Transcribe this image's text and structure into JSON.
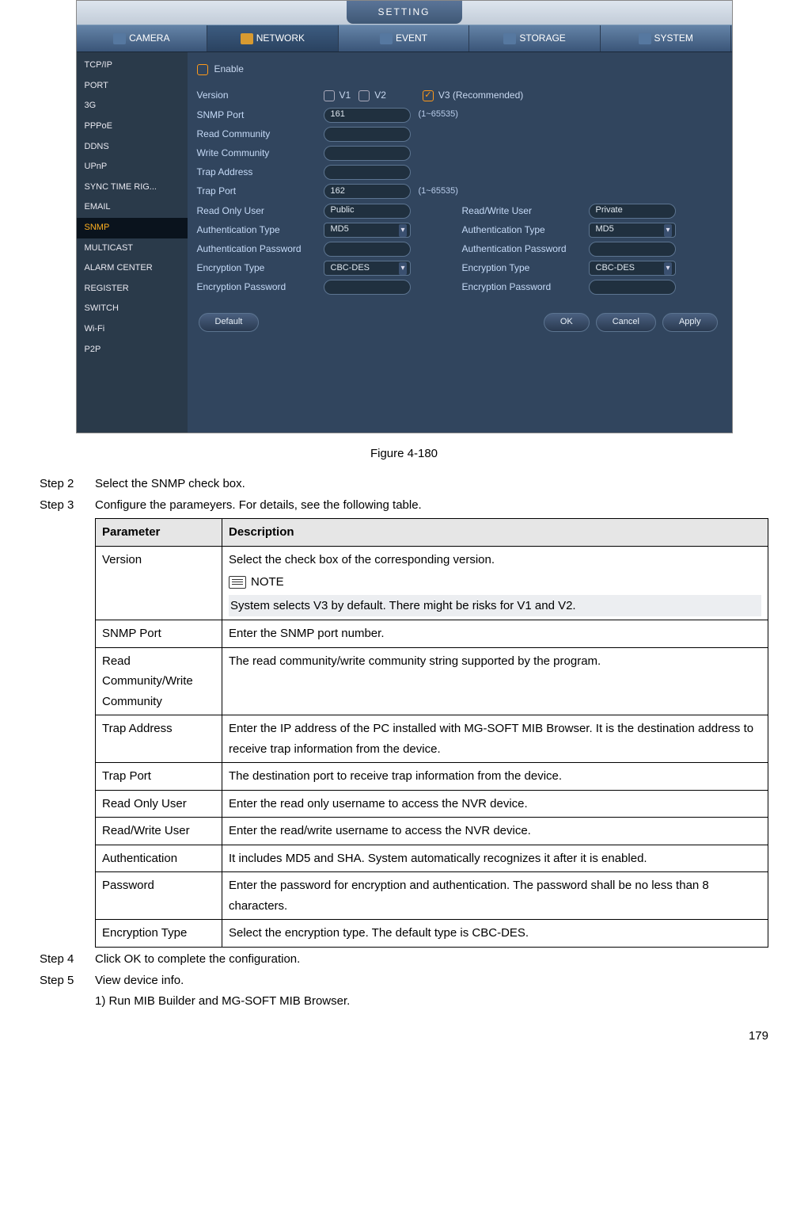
{
  "screenshot": {
    "title_tab": "SETTING",
    "main_tabs": [
      "CAMERA",
      "NETWORK",
      "EVENT",
      "STORAGE",
      "SYSTEM"
    ],
    "active_main_tab": 1,
    "sidebar": [
      "TCP/IP",
      "PORT",
      "3G",
      "PPPoE",
      "DDNS",
      "UPnP",
      "SYNC TIME RIG...",
      "EMAIL",
      "SNMP",
      "MULTICAST",
      "ALARM CENTER",
      "REGISTER",
      "SWITCH",
      "Wi-Fi",
      "P2P"
    ],
    "active_sidebar": 8,
    "enable_label": "Enable",
    "version_label": "Version",
    "v1": "V1",
    "v2": "V2",
    "v3": "V3 (Recommended)",
    "rows_left": [
      {
        "label": "SNMP Port",
        "value": "161",
        "hint": "(1~65535)",
        "type": "text"
      },
      {
        "label": "Read Community",
        "value": "",
        "type": "text"
      },
      {
        "label": "Write Community",
        "value": "",
        "type": "text"
      },
      {
        "label": "Trap Address",
        "value": "",
        "type": "text"
      },
      {
        "label": "Trap Port",
        "value": "162",
        "hint": "(1~65535)",
        "type": "text"
      },
      {
        "label": "Read Only User",
        "value": "Public",
        "type": "text"
      },
      {
        "label": "Authentication Type",
        "value": "MD5",
        "type": "select"
      },
      {
        "label": "Authentication Password",
        "value": "",
        "type": "text"
      },
      {
        "label": "Encryption Type",
        "value": "CBC-DES",
        "type": "select"
      },
      {
        "label": "Encryption Password",
        "value": "",
        "type": "text"
      }
    ],
    "rows_right": [
      {
        "label": "Read/Write User",
        "value": "Private",
        "type": "text"
      },
      {
        "label": "Authentication Type",
        "value": "MD5",
        "type": "select"
      },
      {
        "label": "Authentication Password",
        "value": "",
        "type": "text"
      },
      {
        "label": "Encryption Type",
        "value": "CBC-DES",
        "type": "select"
      },
      {
        "label": "Encryption Password",
        "value": "",
        "type": "text"
      }
    ],
    "buttons": {
      "default": "Default",
      "ok": "OK",
      "cancel": "Cancel",
      "apply": "Apply"
    }
  },
  "figure_caption": "Figure 4-180",
  "steps": {
    "s2_label": "Step 2",
    "s2_body": "Select the SNMP check box.",
    "s3_label": "Step 3",
    "s3_body": "Configure the parameyers. For details, see the following table.",
    "s4_label": "Step 4",
    "s4_body": "Click OK to complete the configuration.",
    "s5_label": "Step 5",
    "s5_body": "View device info.",
    "s5_sub1": "1)    Run MIB Builder and MG-SOFT MIB Browser."
  },
  "table": {
    "h1": "Parameter",
    "h2": "Description",
    "rows": [
      {
        "param": "Version",
        "desc_top": "Select the check box of the corresponding version.",
        "note_label": "NOTE",
        "desc_note": "System selects V3 by default. There might be risks for V1 and V2."
      },
      {
        "param": "SNMP Port",
        "desc": "Enter the SNMP port number."
      },
      {
        "param": "Read Community/Write Community",
        "desc": "The read community/write community string supported by the program."
      },
      {
        "param": "Trap Address",
        "desc": "Enter the IP address of the PC installed with MG-SOFT MIB Browser. It is the destination address to receive trap information from the device."
      },
      {
        "param": "Trap Port",
        "desc": "The destination port to receive trap information from the device."
      },
      {
        "param": "Read Only User",
        "desc": "Enter the read only username to access the NVR device."
      },
      {
        "param": "Read/Write User",
        "desc": "Enter the read/write username to access the NVR device."
      },
      {
        "param": "Authentication",
        "desc": "It includes MD5 and SHA. System automatically recognizes it after it is enabled."
      },
      {
        "param": "Password",
        "desc": "Enter the password for encryption and authentication. The password shall be no less than 8 characters."
      },
      {
        "param": "Encryption Type",
        "desc": "Select the encryption type. The default type is CBC-DES."
      }
    ]
  },
  "page_number": "179"
}
